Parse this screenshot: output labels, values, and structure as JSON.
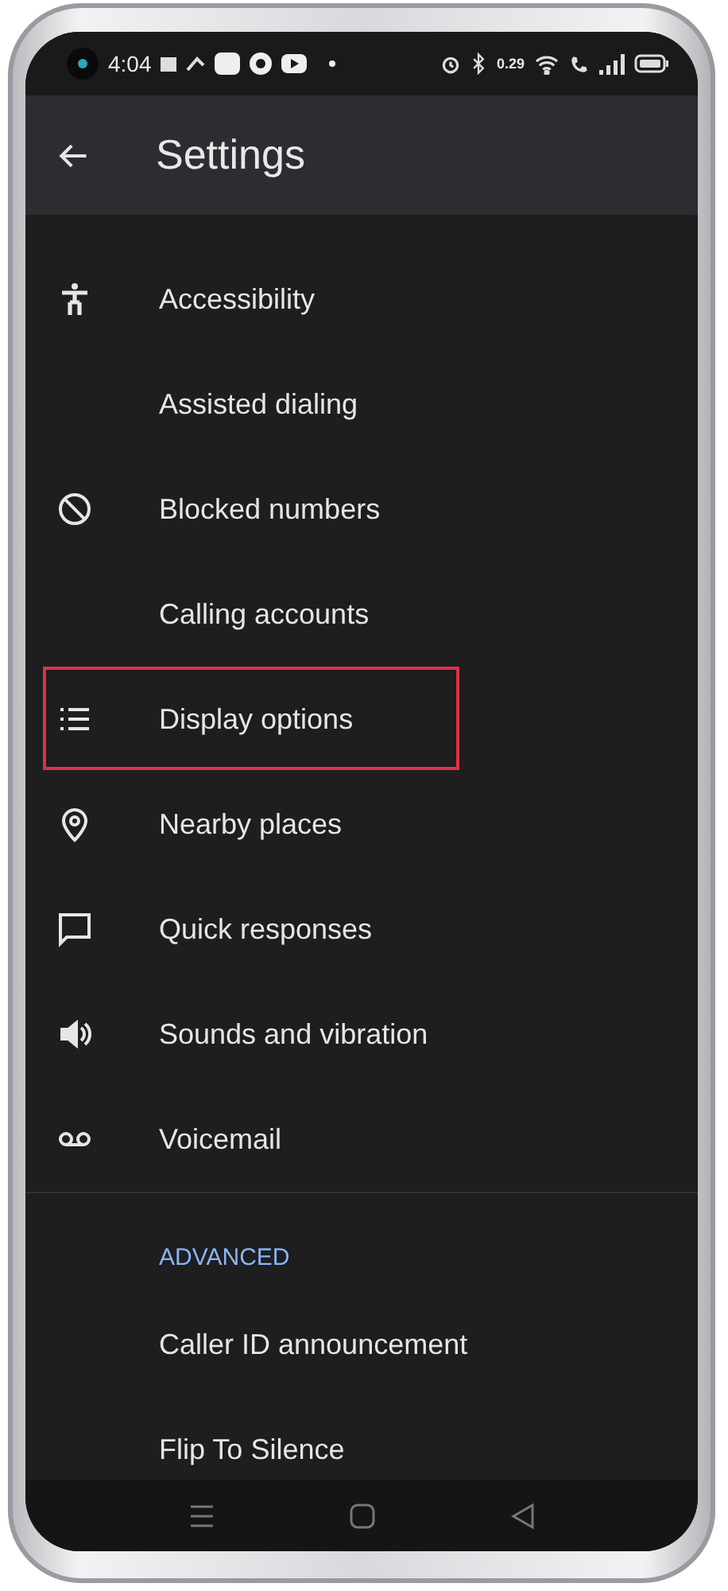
{
  "status_bar": {
    "time": "4:04",
    "net_speed": "0.29"
  },
  "header": {
    "title": "Settings"
  },
  "sections": [
    {
      "items": [
        {
          "label": "Accessibility",
          "kind": "accessibility",
          "highlighted": false
        },
        {
          "label": "Assisted dialing",
          "highlighted": false
        },
        {
          "label": "Blocked numbers",
          "kind": "block",
          "highlighted": false
        },
        {
          "label": "Calling accounts",
          "highlighted": false
        },
        {
          "label": "Display options",
          "kind": "list",
          "highlighted": true
        },
        {
          "label": "Nearby places",
          "kind": "pin",
          "highlighted": false
        },
        {
          "label": "Quick responses",
          "kind": "message",
          "highlighted": false
        },
        {
          "label": "Sounds and vibration",
          "kind": "volume",
          "highlighted": false
        },
        {
          "label": "Voicemail",
          "kind": "voicemail",
          "highlighted": false
        }
      ]
    },
    {
      "heading": "ADVANCED",
      "items": [
        {
          "label": "Caller ID announcement",
          "highlighted": false
        },
        {
          "label": "Flip To Silence",
          "highlighted": false
        }
      ]
    }
  ]
}
